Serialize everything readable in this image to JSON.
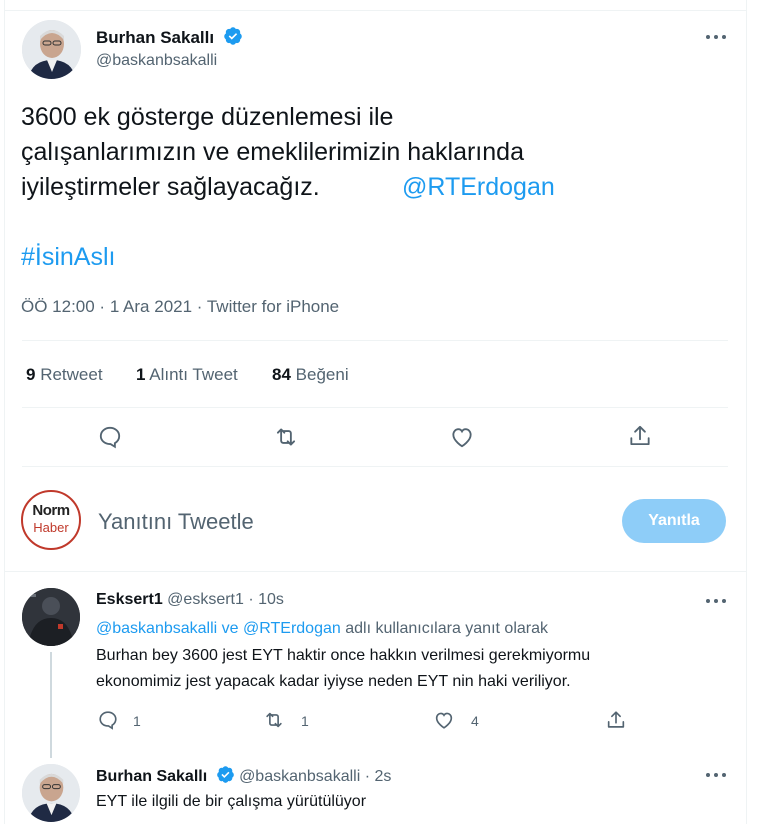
{
  "main_tweet": {
    "author_name": "Burhan Sakallı",
    "author_handle": "@baskanbsakalli",
    "text_line1": "3600 ek gösterge düzenlemesi ile",
    "text_line2": "çalışanlarımızın ve emeklilerimizin haklarında",
    "text_line3": "iyileştirmeler sağlayacağız.",
    "mention": "@RTErdogan",
    "hashtag": "#İsinAslı",
    "timestamp": "ÖÖ 12:00 · 1 Ara 2021 · Twitter for iPhone",
    "stats": {
      "retweet_count": "9",
      "retweet_label": "Retweet",
      "quote_count": "1",
      "quote_label": "Alıntı Tweet",
      "like_count": "84",
      "like_label": "Beğeni"
    }
  },
  "compose": {
    "avatar_text_top": "Norm",
    "avatar_text_bottom": "Haber",
    "placeholder": "Yanıtını Tweetle",
    "reply_button": "Yanıtla"
  },
  "reply1": {
    "author_name": "Esksert1",
    "author_handle": "@esksert1",
    "time": "· 10s",
    "replying_mentions": "@baskanbsakalli ve @RTErdogan",
    "replying_suffix": "adlı kullanıcılara yanıt olarak",
    "text_line1": "Burhan bey 3600 jest EYT haktir once hakkın verilmesi gerekmiyormu",
    "text_line2": "ekonomimiz jest yapacak kadar iyiyse neden EYT nin haki veriliyor.",
    "reply_count": "1",
    "retweet_count": "1",
    "like_count": "4"
  },
  "reply2": {
    "author_name": "Burhan Sakallı",
    "author_handle": "@baskanbsakalli",
    "time": "· 2s",
    "text": "EYT ile ilgili de bir çalışma yürütülüyor"
  },
  "colors": {
    "accent": "#1d9bf0",
    "button_disabled": "#8ecdf8",
    "secondary_text": "#536471"
  }
}
